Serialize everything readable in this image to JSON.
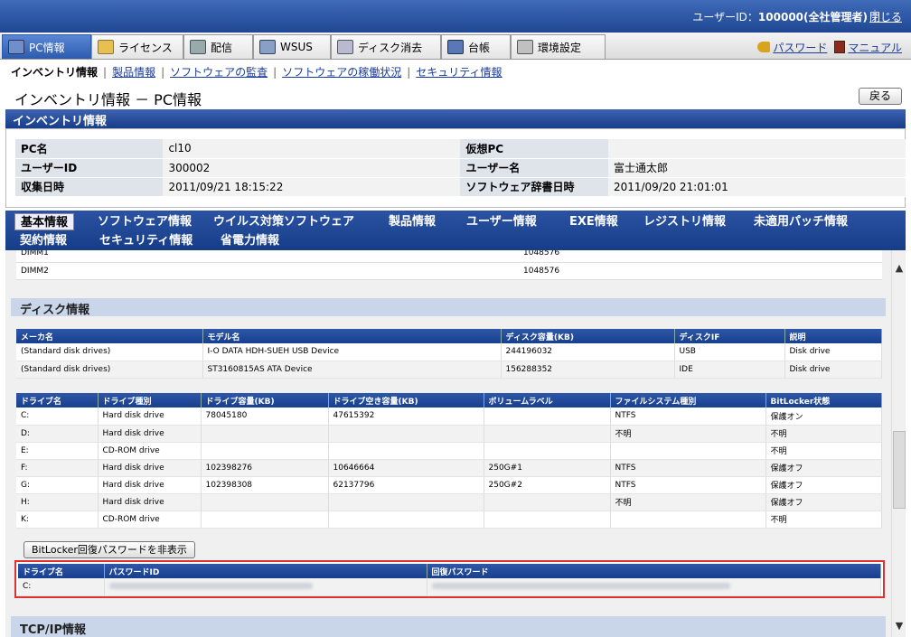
{
  "header": {
    "user_label": "ユーザーID：",
    "user_value": "100000(全社管理者)",
    "separator": "|",
    "logout": "閉じる"
  },
  "menu_tabs": [
    {
      "label": "PC情報",
      "icon": "pc-icon"
    },
    {
      "label": "ライセンス",
      "icon": "license-icon"
    },
    {
      "label": "配信",
      "icon": "distribution-icon"
    },
    {
      "label": "WSUS",
      "icon": "wsus-icon"
    },
    {
      "label": "ディスク消去",
      "icon": "disk-erase-icon"
    },
    {
      "label": "台帳",
      "icon": "ledger-icon"
    },
    {
      "label": "環境設定",
      "icon": "settings-icon"
    }
  ],
  "top_links": {
    "password": "パスワード",
    "manual": "マニュアル"
  },
  "submenu": {
    "current": "インベントリ情報",
    "links": [
      "製品情報",
      "ソフトウェアの監査",
      "ソフトウェアの稼働状況",
      "セキュリティ情報"
    ]
  },
  "page": {
    "title": "インベントリ情報 － PC情報",
    "back_button": "戻る"
  },
  "inventory": {
    "section_title": "インベントリ情報",
    "rows": [
      {
        "l1": "PC名",
        "v1": "cl10",
        "l2": "仮想PC",
        "v2": ""
      },
      {
        "l1": "ユーザーID",
        "v1": "300002",
        "l2": "ユーザー名",
        "v2": "富士通太郎"
      },
      {
        "l1": "収集日時",
        "v1": "2011/09/21 18:15:22",
        "l2": "ソフトウェア辞書日時",
        "v2": "2011/09/20 21:01:01"
      }
    ]
  },
  "detail_tabs": {
    "row1": [
      "基本情報",
      "ソフトウェア情報",
      "ウイルス対策ソフトウェア",
      "製品情報",
      "ユーザー情報",
      "EXE情報",
      "レジストリ情報",
      "未適用パッチ情報"
    ],
    "row2": [
      "契約情報",
      "セキュリティ情報",
      "省電力情報"
    ]
  },
  "memory_rows": [
    {
      "name": "DIMM1",
      "size": "1048576"
    },
    {
      "name": "DIMM2",
      "size": "1048576"
    }
  ],
  "disk": {
    "section_title": "ディスク情報",
    "disk_headers": [
      "メーカ名",
      "モデル名",
      "ディスク容量(KB)",
      "ディスクIF",
      "説明"
    ],
    "disks": [
      [
        "(Standard disk drives)",
        "I-O DATA HDH-SUEH USB Device",
        "244196032",
        "USB",
        "Disk drive"
      ],
      [
        "(Standard disk drives)",
        "ST3160815AS ATA Device",
        "156288352",
        "IDE",
        "Disk drive"
      ]
    ],
    "drive_headers": [
      "ドライブ名",
      "ドライブ種別",
      "ドライブ容量(KB)",
      "ドライブ空き容量(KB)",
      "ボリュームラベル",
      "ファイルシステム種別",
      "BitLocker状態"
    ],
    "drives": [
      [
        "C:",
        "Hard disk drive",
        "78045180",
        "47615392",
        "",
        "NTFS",
        "保護オン"
      ],
      [
        "D:",
        "Hard disk drive",
        "",
        "",
        "",
        "不明",
        "不明"
      ],
      [
        "E:",
        "CD-ROM drive",
        "",
        "",
        "",
        "",
        "不明"
      ],
      [
        "F:",
        "Hard disk drive",
        "102398276",
        "10646664",
        "250G#1",
        "NTFS",
        "保護オフ"
      ],
      [
        "G:",
        "Hard disk drive",
        "102398308",
        "62137796",
        "250G#2",
        "NTFS",
        "保護オフ"
      ],
      [
        "H:",
        "Hard disk drive",
        "",
        "",
        "",
        "不明",
        "保護オフ"
      ],
      [
        "K:",
        "CD-ROM drive",
        "",
        "",
        "",
        "",
        "不明"
      ]
    ],
    "bitlocker_button": "BitLocker回復パスワードを非表示",
    "recovery_headers": [
      "ドライブ名",
      "パスワードID",
      "回復パスワード"
    ],
    "recovery_rows": [
      {
        "drive": "C:"
      }
    ]
  },
  "tcp": {
    "section_title": "TCP/IP情報"
  }
}
